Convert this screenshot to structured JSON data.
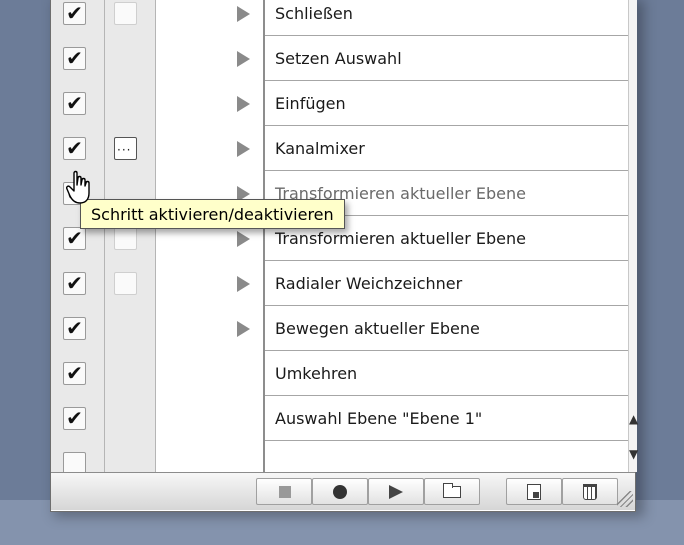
{
  "actions": [
    {
      "label": "Schließen",
      "checked": true,
      "dialog": "empty",
      "expandable": true
    },
    {
      "label": "Setzen Auswahl",
      "checked": true,
      "dialog": "none",
      "expandable": true
    },
    {
      "label": "Einfügen",
      "checked": true,
      "dialog": "none",
      "expandable": true
    },
    {
      "label": "Kanalmixer",
      "checked": true,
      "dialog": "active",
      "expandable": true
    },
    {
      "label": "Transformieren aktueller Ebene",
      "checked": true,
      "dialog": "none",
      "expandable": true
    },
    {
      "label": "Transformieren aktueller Ebene",
      "checked": true,
      "dialog": "empty",
      "expandable": true
    },
    {
      "label": "Radialer Weichzeichner",
      "checked": true,
      "dialog": "empty",
      "expandable": true
    },
    {
      "label": "Bewegen aktueller Ebene",
      "checked": true,
      "dialog": "none",
      "expandable": true
    },
    {
      "label": "Umkehren",
      "checked": true,
      "dialog": "none",
      "expandable": false
    },
    {
      "label": "Auswahl Ebene \"Ebene 1\"",
      "checked": true,
      "dialog": "none",
      "expandable": false
    },
    {
      "label": "",
      "checked": false,
      "dialog": "none",
      "expandable": false
    }
  ],
  "check_glyph": "✔",
  "tooltip": {
    "text": "Schritt aktivieren/deaktivieren"
  },
  "toolbar": [
    "stop-icon",
    "record-icon",
    "play-icon",
    "new-set-icon",
    "new-action-icon",
    "trash-icon"
  ],
  "scroll_glyphs": {
    "up": "▲",
    "down": "▼"
  }
}
